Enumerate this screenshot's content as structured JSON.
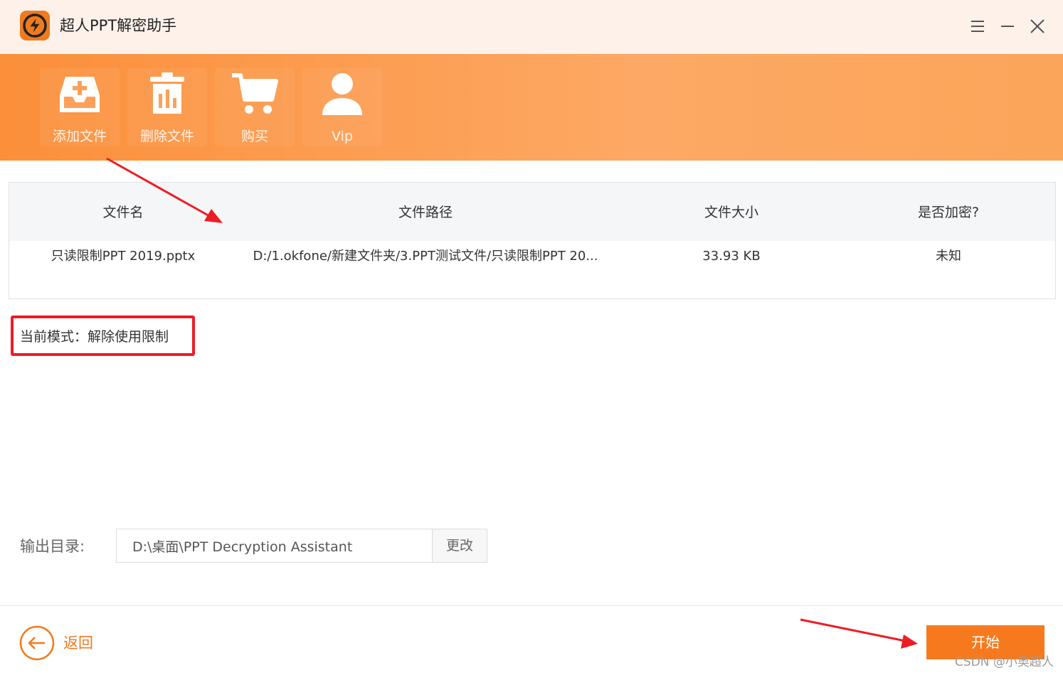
{
  "window": {
    "title": "超人PPT解密助手",
    "controls": [
      "menu-icon",
      "minimize-icon",
      "close-icon"
    ]
  },
  "toolbar": {
    "items": [
      {
        "label": "添加文件",
        "icon": "add-file-icon"
      },
      {
        "label": "删除文件",
        "icon": "trash-icon"
      },
      {
        "label": "购买",
        "icon": "cart-icon"
      },
      {
        "label": "Vip",
        "icon": "user-icon"
      }
    ]
  },
  "table": {
    "headers": [
      "文件名",
      "文件路径",
      "文件大小",
      "是否加密?"
    ],
    "rows": [
      {
        "name": "只读限制PPT 2019.pptx",
        "path": "D:/1.okfone/新建文件夹/3.PPT测试文件/只读限制PPT 20...",
        "size": "33.93 KB",
        "encrypted": "未知"
      }
    ]
  },
  "mode": {
    "text": "当前模式：解除使用限制"
  },
  "output": {
    "label": "输出目录:",
    "value": "D:\\桌面\\PPT Decryption Assistant",
    "change_label": "更改"
  },
  "footer": {
    "back_label": "返回",
    "start_label": "开始"
  },
  "watermark": "CSDN @小奥超人",
  "colors": {
    "accent": "#f67a1d",
    "toolbar_start": "#fb8f3a",
    "toolbar_end": "#fba55a",
    "titlebar_bg": "#fdf1ea",
    "highlight": "#ee1c24"
  }
}
